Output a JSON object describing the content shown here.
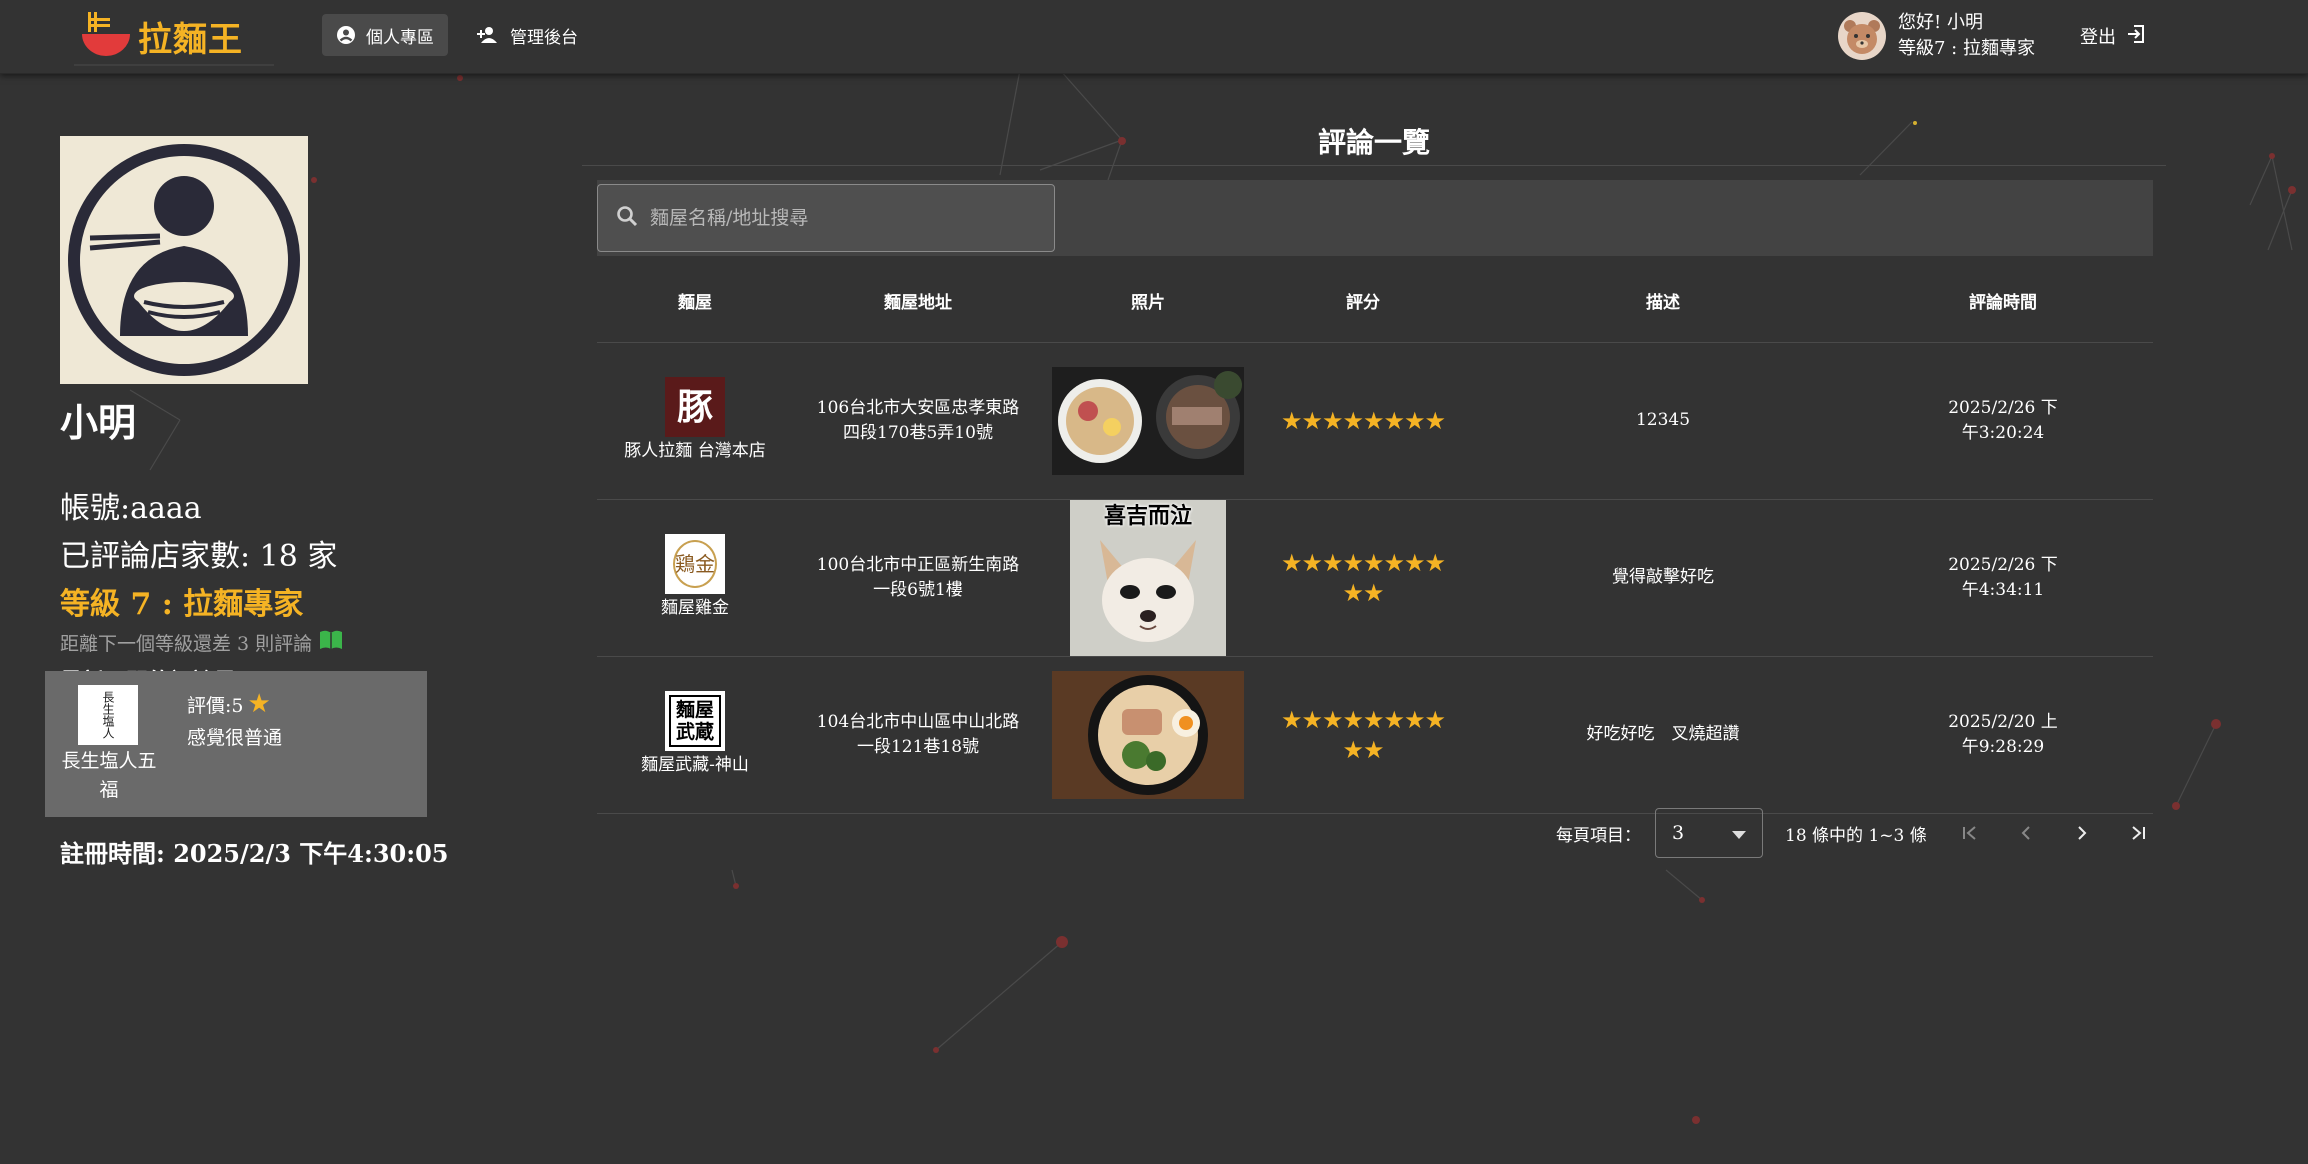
{
  "navbar": {
    "logo_text": "拉麵王",
    "nav_personal": "個人專區",
    "nav_admin": "管理後台",
    "greeting": "您好! 小明",
    "user_level": "等級7 : 拉麵專家",
    "logout": "登出"
  },
  "profile": {
    "name": "小明",
    "account": "帳號:aaaa",
    "review_count": "已評論店家數: 18 家",
    "level": "等級 7 : 拉麵專家",
    "next_level": "距離下一個等級還差 3 則評論",
    "latest_title": "最新一間的評論是:",
    "latest": {
      "shop": "長生塩人五福",
      "logo_text": "長生塩人",
      "rating_label": "評價:5",
      "desc": "感覺很普通"
    },
    "register_time": "註冊時間: 2025/2/3 下午4:30:05"
  },
  "reviews": {
    "title": "評論一覽",
    "search_placeholder": "麵屋名稱/地址搜尋",
    "columns": [
      "麵屋",
      "麵屋地址",
      "照片",
      "評分",
      "描述",
      "評論時間"
    ],
    "rows": [
      {
        "shop": "豚人拉麵 台灣本店",
        "logo_glyph": "豚",
        "address": "106台北市大安區忠孝東路四段170巷5弄10號",
        "stars_line1": "★★★★★★★★",
        "stars_line2": "",
        "rating": 8,
        "desc": "12345",
        "time": "2025/2/26 下午3:20:24"
      },
      {
        "shop": "麵屋雞金",
        "logo_glyph": "鶏金",
        "address": "100台北市中正區新生南路一段6號1樓",
        "photo_caption": "喜吉而泣",
        "stars_line1": "★★★★★★★★",
        "stars_line2": "★★",
        "rating": 10,
        "desc": "覺得敲擊好吃",
        "time": "2025/2/26 下午4:34:11"
      },
      {
        "shop": "麵屋武藏-神山",
        "logo_glyph": "麵屋武蔵",
        "address": "104台北市中山區中山北路一段121巷18號",
        "stars_line1": "★★★★★★★★",
        "stars_line2": "★★",
        "rating": 10,
        "desc": "好吃好吃　叉燒超讚",
        "time": "2025/2/20 上午9:28:29"
      }
    ]
  },
  "pagination": {
    "per_page_label": "每頁項目：",
    "per_page_value": "3",
    "range": "18 條中的 1~3 條"
  },
  "colors": {
    "background": "#333333",
    "accent": "#f5b324",
    "card": "#6a6a6a",
    "search_bar": "#434343"
  }
}
